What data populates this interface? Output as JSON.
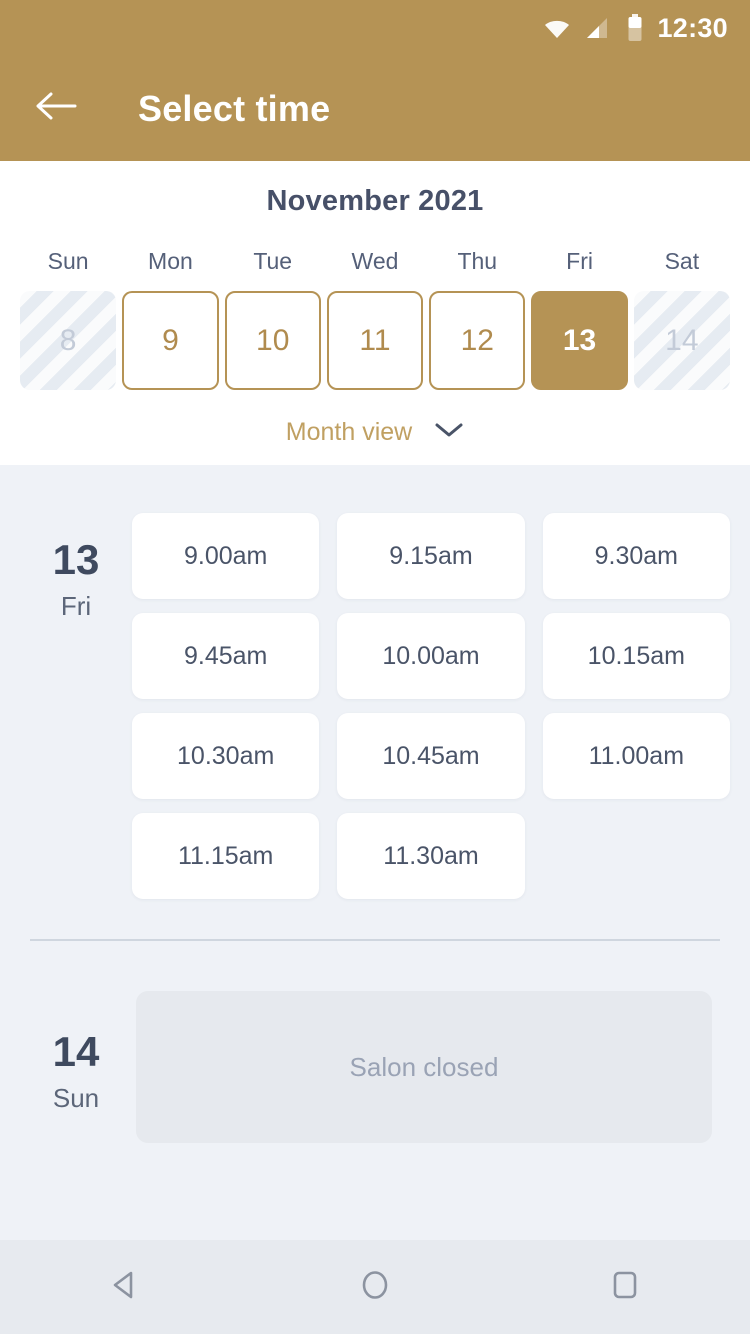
{
  "statusbar": {
    "time": "12:30",
    "icons": [
      "wifi-icon",
      "signal-icon",
      "battery-icon"
    ]
  },
  "appbar": {
    "title": "Select time",
    "back_icon": "arrow-left-icon",
    "background_color": "#B59355",
    "text_color": "#FFFFFF"
  },
  "calendar": {
    "month_title": "November 2021",
    "weekdays": [
      "Sun",
      "Mon",
      "Tue",
      "Wed",
      "Thu",
      "Fri",
      "Sat"
    ],
    "dates": [
      {
        "day": "8",
        "state": "disabled"
      },
      {
        "day": "9",
        "state": "available"
      },
      {
        "day": "10",
        "state": "available"
      },
      {
        "day": "11",
        "state": "available"
      },
      {
        "day": "12",
        "state": "available"
      },
      {
        "day": "13",
        "state": "selected"
      },
      {
        "day": "14",
        "state": "disabled"
      }
    ],
    "view_toggle_label": "Month view",
    "view_toggle_icon": "chevron-down-icon",
    "accent_color": "#B59355",
    "disabled_color": "#C3CBD8"
  },
  "schedule": {
    "days": [
      {
        "number": "13",
        "weekday": "Fri",
        "closed": false,
        "slots": [
          "9.00am",
          "9.15am",
          "9.30am",
          "9.45am",
          "10.00am",
          "10.15am",
          "10.30am",
          "10.45am",
          "11.00am",
          "11.15am",
          "11.30am"
        ]
      },
      {
        "number": "14",
        "weekday": "Sun",
        "closed": true,
        "closed_message": "Salon closed",
        "slots": []
      }
    ]
  },
  "navbar": {
    "back_icon": "triangle-back-icon",
    "home_icon": "circle-home-icon",
    "recents_icon": "square-recents-icon"
  }
}
